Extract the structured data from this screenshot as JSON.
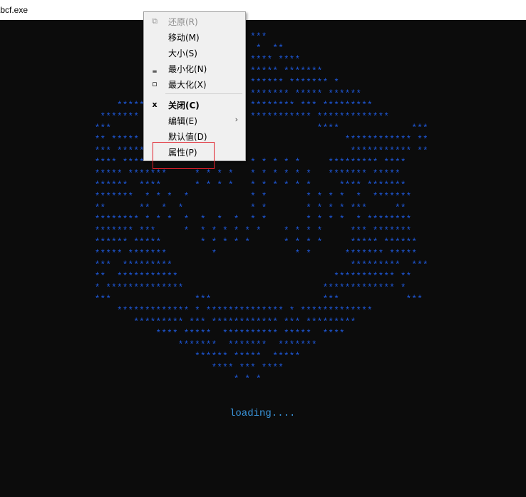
{
  "window": {
    "title": "\\bcf.exe"
  },
  "console": {
    "ascii_art": [
      "                                             ***",
      "                                              *  **",
      "                                             **** ****",
      "                                             ***** *******",
      "                                             ****** ******* *",
      "                                             ******* ***** ******",
      "                     *******                 ******** *** *********",
      "                  *******                    *********** *************",
      "                 ***                                     ****             ***",
      "                 ** *****                                     ************ **",
      "                 *** ******                                    *********** **",
      "                 **** ********      *  *     * * * * *     ********* ****",
      "                 ***** *******     * * * *   * * * * * *   ******* *****",
      "                 ******  ****      * * * *   * * * * * *     **** *******",
      "                 *******  * * *  *           * *       * * * *  *  *******",
      "                 **      **  *  *            * *       * * * * ***     **",
      "                 ******** * * *  *  *  *  *  * *       * * * *  * ********",
      "                 ******* ***     *  * * * * * *    * * * *     *** *******",
      "                 ****** *****       * * * * *      * * * *     ***** ******",
      "                 ***** *******        *              * *      ******* *****",
      "                 ***  *********                                *********  ***",
      "                 **  ***********                            *********** **",
      "                 * **************                         ************* *",
      "                 ***               ***                    ***            ***",
      "                     ************* * ************** * *************",
      "                        ********* *** ************ *** *********",
      "                            **** *****  ********** *****  ****",
      "                                *******  *******  *******",
      "                                   ****** *****  *****",
      "                                      **** *** ****",
      "                                          * * *"
    ],
    "loading_text": "loading...."
  },
  "context_menu": {
    "items": [
      {
        "label": "还原(R)",
        "icon": "restore-icon",
        "icon_glyph": "⧉",
        "disabled": true,
        "bold": false,
        "submenu": false
      },
      {
        "label": "移动(M)",
        "icon": "",
        "icon_glyph": "",
        "disabled": false,
        "bold": false,
        "submenu": false
      },
      {
        "label": "大小(S)",
        "icon": "",
        "icon_glyph": "",
        "disabled": false,
        "bold": false,
        "submenu": false
      },
      {
        "label": "最小化(N)",
        "icon": "minimize-icon",
        "icon_glyph": "‗",
        "disabled": false,
        "bold": false,
        "submenu": false
      },
      {
        "label": "最大化(X)",
        "icon": "maximize-icon",
        "icon_glyph": "▫",
        "disabled": false,
        "bold": false,
        "submenu": false
      },
      {
        "label": "关闭(C)",
        "icon": "close-icon",
        "icon_glyph": "x",
        "disabled": false,
        "bold": true,
        "submenu": false
      },
      {
        "label": "编辑(E)",
        "icon": "",
        "icon_glyph": "",
        "disabled": false,
        "bold": false,
        "submenu": true,
        "submenu_glyph": "›"
      },
      {
        "label": "默认值(D)",
        "icon": "",
        "icon_glyph": "",
        "disabled": false,
        "bold": false,
        "submenu": false
      },
      {
        "label": "属性(P)",
        "icon": "",
        "icon_glyph": "",
        "disabled": false,
        "bold": false,
        "submenu": false
      }
    ]
  },
  "colors": {
    "console_background": "#0c0c0c",
    "ascii_color": "#1f5be0",
    "loading_color": "#3a96dd",
    "highlight_border": "#e0202a"
  }
}
